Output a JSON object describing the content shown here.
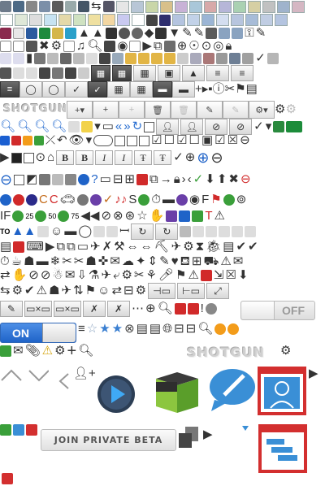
{
  "branding": {
    "logo_text": "SHOTGUN",
    "logo_text_large": "SHOTGUN"
  },
  "toggles": {
    "off_label": "OFF",
    "on_label": "ON"
  },
  "buttons": {
    "join_beta": "JOIN PRIVATE BETA"
  },
  "format_labels": [
    "B",
    "B",
    "I",
    "I",
    "Ŧ",
    "Ŧ"
  ],
  "progress_labels": [
    "25",
    "50",
    "75"
  ],
  "misc_text": {
    "to": "TO",
    "if": "IF",
    "s": "S",
    "f": "F"
  },
  "colors": {
    "accent_blue": "#1f63c8",
    "icon_green": "#5a9e2a",
    "icon_red": "#d62b2b",
    "dark_button": "#3d3d3d",
    "pale_tile": "#dfe8d8"
  },
  "icons": [
    "folder-icon",
    "database-icon",
    "gear-icon",
    "calendar-icon",
    "person-icon",
    "arrow-icon",
    "tag-icon",
    "layers-icon",
    "search-icon",
    "plus-icon",
    "minus-icon",
    "trash-icon",
    "pencil-icon",
    "comment-icon",
    "play-icon",
    "cube-icon",
    "chat-bubble-icon",
    "user-card-icon",
    "lock-icon",
    "star-icon",
    "close-icon",
    "warning-icon",
    "refresh-icon",
    "chevron-down-icon",
    "mail-icon"
  ]
}
